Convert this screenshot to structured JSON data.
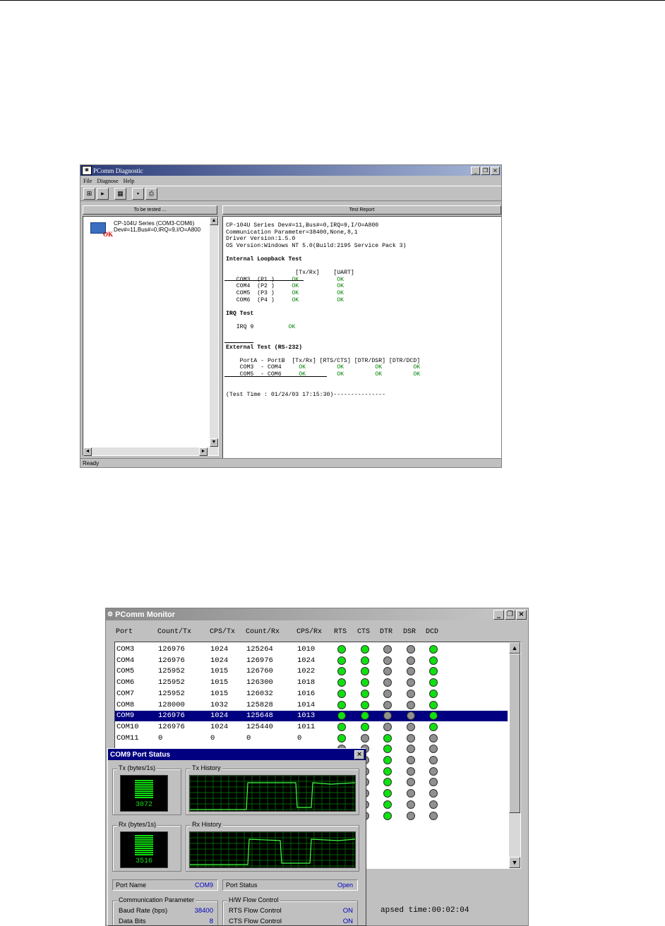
{
  "diag": {
    "title": "PComm Diagnostic",
    "menu": [
      "File",
      "Diagnose",
      "Help"
    ],
    "left_header": "To be tested ...",
    "right_header": "Test Report",
    "device_line1": "CP-104U Series (COM3-COM6)",
    "device_line2": "Dev#=11,Bus#=0,IRQ=9,I/O=A800",
    "device_ok": "OK",
    "status": "Ready",
    "report": {
      "line1": "CP-104U Series Dev#=11,Bus#=0,IRQ=9,I/O=A800",
      "line2": "Communication Parameter=38400,None,8,1",
      "line3": "Driver Version:1.5.0",
      "line4": "OS Version:Windows NT 5.0(Build:2195 Service Pack 3)",
      "loop_title": "Internal Loopback Test",
      "loop_hdr_txrx": "[Tx/Rx]",
      "loop_hdr_uart": "[UART]",
      "loop_rows": [
        {
          "com": "COM3",
          "port": "(P1 )",
          "txrx": "OK",
          "uart": "OK"
        },
        {
          "com": "COM4",
          "port": "(P2 )",
          "txrx": "OK",
          "uart": "OK"
        },
        {
          "com": "COM5",
          "port": "(P3 )",
          "txrx": "OK",
          "uart": "OK"
        },
        {
          "com": "COM6",
          "port": "(P4 )",
          "txrx": "OK",
          "uart": "OK"
        }
      ],
      "irq_title": "IRQ Test",
      "irq_label": "IRQ 9",
      "irq_result": "OK",
      "ext_title": "External Test (RS-232)",
      "ext_hdr": "PortA - PortB  [Tx/Rx] [RTS/CTS] [DTR/DSR] [DTR/DCD]",
      "ext_rows": [
        {
          "pair": "COM3  - COM4",
          "r1": "OK",
          "r2": "OK",
          "r3": "OK",
          "r4": "OK"
        },
        {
          "pair": "COM5  - COM6",
          "r1": "OK",
          "r2": "OK",
          "r3": "OK",
          "r4": "OK"
        }
      ],
      "test_time": "(Test Time : 01/24/03 17:15:30)---------------"
    }
  },
  "mon": {
    "title": "PComm Monitor",
    "columns": [
      "Port",
      "Count/Tx",
      "CPS/Tx",
      "Count/Rx",
      "CPS/Rx",
      "RTS",
      "CTS",
      "DTR",
      "DSR",
      "DCD"
    ],
    "rows": [
      {
        "port": "COM3",
        "ctx": "126976",
        "cpstx": "1024",
        "crx": "125264",
        "cpsrx": "1010",
        "leds": [
          1,
          1,
          0,
          0,
          1
        ]
      },
      {
        "port": "COM4",
        "ctx": "126976",
        "cpstx": "1024",
        "crx": "126976",
        "cpsrx": "1024",
        "leds": [
          1,
          1,
          0,
          0,
          1
        ]
      },
      {
        "port": "COM5",
        "ctx": "125952",
        "cpstx": "1015",
        "crx": "126760",
        "cpsrx": "1022",
        "leds": [
          1,
          1,
          0,
          0,
          1
        ]
      },
      {
        "port": "COM6",
        "ctx": "125952",
        "cpstx": "1015",
        "crx": "126300",
        "cpsrx": "1018",
        "leds": [
          1,
          1,
          0,
          0,
          1
        ]
      },
      {
        "port": "COM7",
        "ctx": "125952",
        "cpstx": "1015",
        "crx": "126032",
        "cpsrx": "1016",
        "leds": [
          1,
          1,
          0,
          0,
          1
        ]
      },
      {
        "port": "COM8",
        "ctx": "128000",
        "cpstx": "1032",
        "crx": "125828",
        "cpsrx": "1014",
        "leds": [
          1,
          1,
          0,
          0,
          1
        ]
      },
      {
        "port": "COM9",
        "ctx": "126976",
        "cpstx": "1024",
        "crx": "125648",
        "cpsrx": "1013",
        "leds": [
          1,
          1,
          0,
          0,
          1
        ],
        "selected": true
      },
      {
        "port": "COM10",
        "ctx": "126976",
        "cpstx": "1024",
        "crx": "125440",
        "cpsrx": "1011",
        "leds": [
          1,
          1,
          0,
          0,
          1
        ]
      },
      {
        "port": "COM11",
        "ctx": "0",
        "cpstx": "0",
        "crx": "0",
        "cpsrx": "0",
        "leds": [
          1,
          0,
          1,
          0,
          0
        ]
      },
      {
        "port": "",
        "ctx": "",
        "cpstx": "",
        "crx": "",
        "cpsrx": "",
        "leds": [
          0,
          0,
          1,
          0,
          0
        ]
      },
      {
        "port": "",
        "ctx": "",
        "cpstx": "",
        "crx": "",
        "cpsrx": "",
        "leds": [
          0,
          0,
          1,
          0,
          0
        ]
      },
      {
        "port": "",
        "ctx": "",
        "cpstx": "",
        "crx": "",
        "cpsrx": "",
        "leds": [
          0,
          0,
          1,
          0,
          0
        ]
      },
      {
        "port": "",
        "ctx": "",
        "cpstx": "",
        "crx": "",
        "cpsrx": "",
        "leds": [
          0,
          0,
          1,
          0,
          0
        ]
      },
      {
        "port": "",
        "ctx": "",
        "cpstx": "",
        "crx": "",
        "cpsrx": "",
        "leds": [
          0,
          0,
          1,
          0,
          0
        ]
      },
      {
        "port": "",
        "ctx": "",
        "cpstx": "",
        "crx": "",
        "cpsrx": "",
        "leds": [
          0,
          0,
          1,
          0,
          0
        ]
      },
      {
        "port": "",
        "ctx": "",
        "cpstx": "",
        "crx": "",
        "cpsrx": "",
        "leds": [
          0,
          0,
          1,
          0,
          0
        ]
      }
    ],
    "elapsed": "apsed time:00:02:04",
    "led_colors": {
      "on": "#10e010",
      "off": "#909090"
    }
  },
  "portstatus": {
    "title": "COM9 Port Status",
    "tx_label": "Tx (bytes/1s)",
    "tx_value": "3072",
    "tx_history_label": "Tx History",
    "rx_label": "Rx (bytes/1s)",
    "rx_value": "3516",
    "rx_history_label": "Rx History",
    "port_name_label": "Port Name",
    "port_name_value": "COM9",
    "port_status_label": "Port Status",
    "port_status_value": "Open",
    "comm_param_label": "Communication Parameter",
    "baud_label": "Baud Rate (bps)",
    "baud_value": "38400",
    "databits_label": "Data Bits",
    "databits_value": "8",
    "hw_flow_label": "H/W Flow Control",
    "rts_flow_label": "RTS Flow Control",
    "rts_flow_value": "ON",
    "cts_flow_label": "CTS Flow Control",
    "cts_flow_value": "ON"
  }
}
